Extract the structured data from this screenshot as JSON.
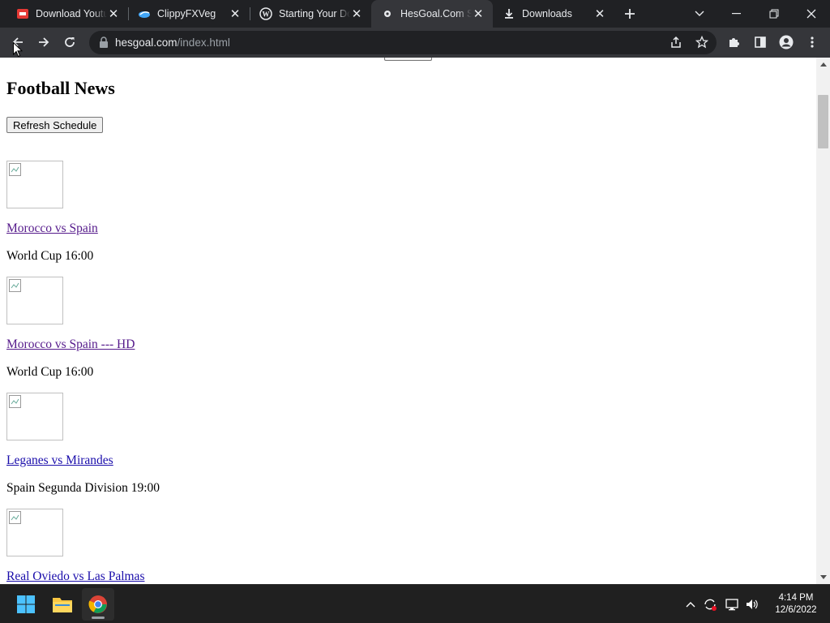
{
  "browser": {
    "tabs": [
      {
        "title": "Download Youtube",
        "icon": "red-video-icon"
      },
      {
        "title": "ClippyFXVeg",
        "icon": "blue-bird-icon"
      },
      {
        "title": "Starting Your Do",
        "icon": "wordpress-icon"
      },
      {
        "title": "HesGoal.Com Sp",
        "icon": "soccer-ball-icon"
      },
      {
        "title": "Downloads",
        "icon": "download-icon"
      }
    ],
    "active_tab_index": 3,
    "url_host": "hesgoal.com",
    "url_path": "/index.html"
  },
  "page": {
    "heading": "Football News",
    "refresh_label": "Refresh Schedule",
    "matches": [
      {
        "title": "Morocco vs Spain",
        "info": "World Cup 16:00",
        "visited": true
      },
      {
        "title": "Morocco vs Spain --- HD",
        "info": "World Cup 16:00",
        "visited": true
      },
      {
        "title": "Leganes vs Mirandes",
        "info": "Spain Segunda Division 19:00",
        "visited": false
      },
      {
        "title": "Real Oviedo vs Las Palmas",
        "info": "",
        "visited": false
      }
    ]
  },
  "taskbar": {
    "time": "4:14 PM",
    "date": "12/6/2022",
    "apps": [
      "windows-start-icon",
      "file-explorer-icon",
      "chrome-icon"
    ]
  }
}
